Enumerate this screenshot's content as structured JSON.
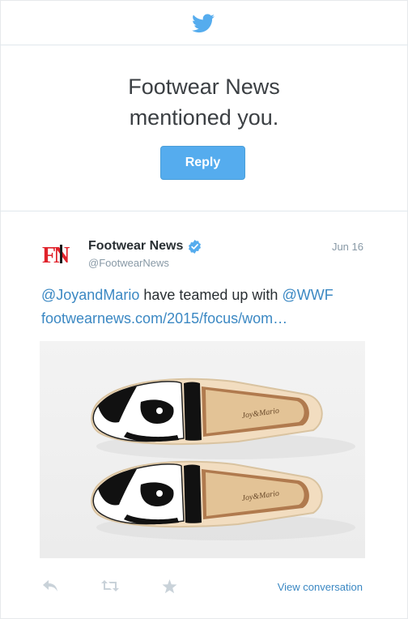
{
  "header": {
    "brand_icon": "twitter-bird-icon",
    "brand_color": "#55acee"
  },
  "notification": {
    "line1": "Footwear News",
    "line2": "mentioned you.",
    "reply_label": "Reply"
  },
  "tweet": {
    "author_name": "Footwear News",
    "author_handle": "@FootwearNews",
    "date": "Jun 16",
    "logo_text": "FN",
    "verified_icon": "verified-badge-icon",
    "text": {
      "mention1": "@JoyandMario",
      "middle": " have teamed up with ",
      "mention2": "@WWF",
      "link": "footwearnews.com/2015/focus/wom…"
    },
    "photo_icon": "panda-espadrilles-photo",
    "insole_text": "Joy&Mario"
  },
  "actions": {
    "reply_icon": "reply-arrow-icon",
    "retweet_icon": "retweet-icon",
    "favorite_icon": "star-icon",
    "view_conversation": "View conversation"
  },
  "colors": {
    "link": "#3b88c3",
    "text": "#292f33",
    "muted": "#8899a6",
    "divider": "#e1e8ed",
    "logo_red": "#e0222b"
  }
}
